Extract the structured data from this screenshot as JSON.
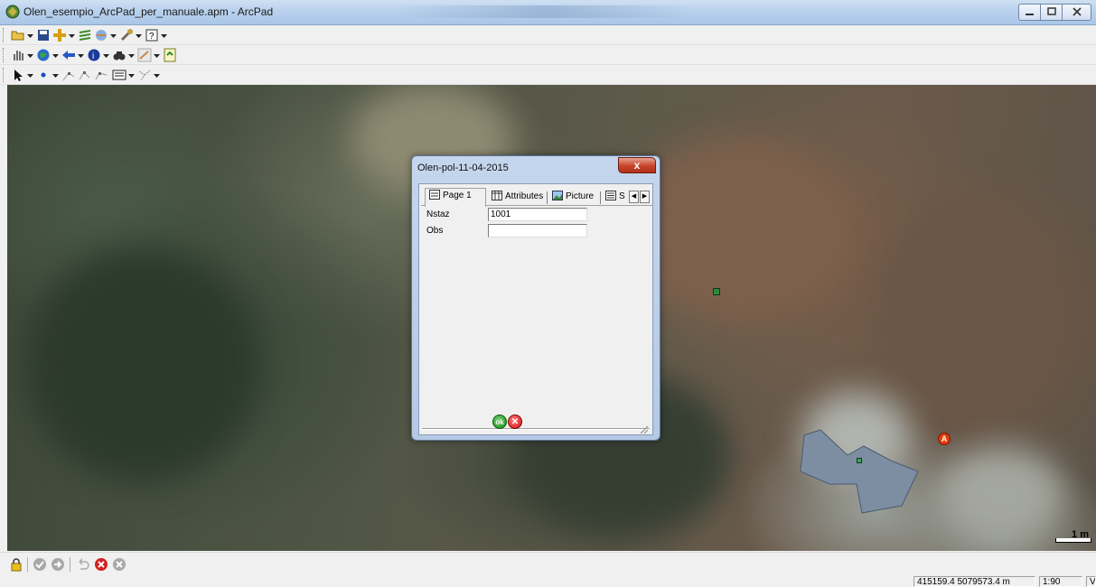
{
  "window": {
    "title": "Olen_esempio_ArcPad_per_manuale.apm - ArcPad"
  },
  "toolbars": {
    "main": [
      "open-folder-icon",
      "save-icon",
      "add-layer-icon",
      "table-of-contents-icon",
      "layer-properties-icon",
      "tools-icon",
      "help-icon"
    ],
    "browse": [
      "pan-icon",
      "zoom-globe-icon",
      "back-icon",
      "identify-icon",
      "find-icon",
      "gps-icon",
      "refresh-icon"
    ],
    "edit": [
      "select-arrow-icon",
      "point-icon",
      "vertex-icon",
      "vertex-edit-icon",
      "vertex-move-icon",
      "form-icon",
      "polyline-icon"
    ]
  },
  "dialog": {
    "title": "Olen-pol-11-04-2015",
    "close_label": "x",
    "tabs": [
      {
        "label": "Page 1",
        "icon": "form-page-icon",
        "active": true
      },
      {
        "label": "Attributes",
        "icon": "table-icon",
        "active": false
      },
      {
        "label": "Picture",
        "icon": "picture-icon",
        "active": false
      },
      {
        "label": "S",
        "icon": "list-icon",
        "active": false
      }
    ],
    "fields": [
      {
        "label": "Nstaz",
        "value": "1001"
      },
      {
        "label": "Obs",
        "value": ""
      }
    ],
    "ok_label": "ok",
    "cancel_label": "✕"
  },
  "map": {
    "scale_bar_label": "1 m",
    "gps_marker_label": "A",
    "polygon_color": "#7d8ea3"
  },
  "bottom_toolbar": [
    "lock-icon",
    "check-icon",
    "forward-icon",
    "undo-icon",
    "cancel-red-icon",
    "cancel-gray-icon"
  ],
  "status": {
    "coordinates": "415159.4 5079573.4 m",
    "scale": "1:90",
    "extra": "V"
  }
}
